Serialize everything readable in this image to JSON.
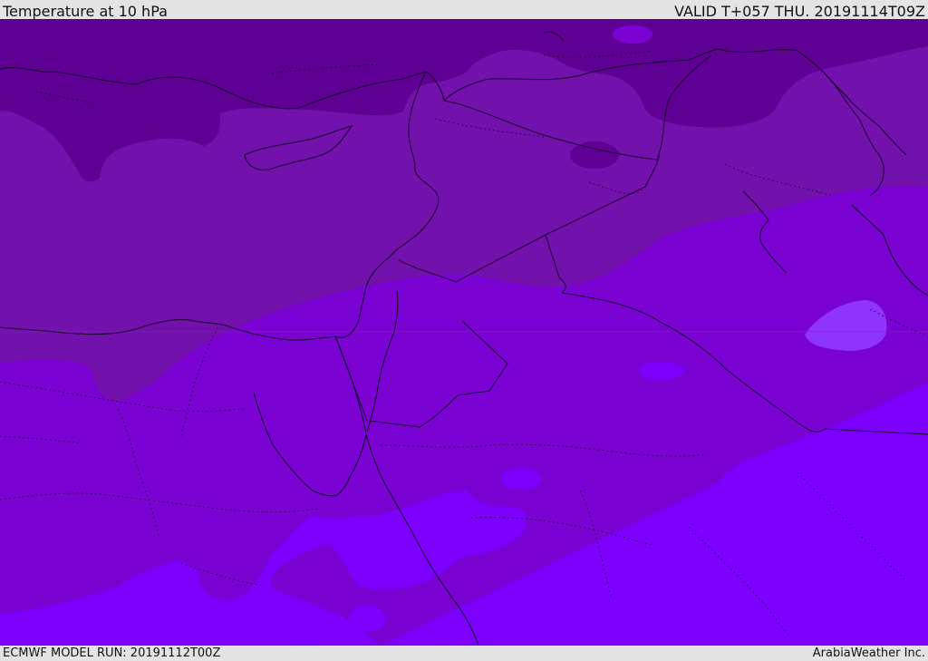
{
  "header": {
    "title": "Temperature at 10 hPa",
    "valid": "VALID T+057 THU. 20191114T09Z"
  },
  "footer": {
    "model_run": "ECMWF MODEL RUN: 20191112T00Z",
    "credit": "ArabiaWeather Inc."
  },
  "colors": {
    "band_darkest": "#5e0094",
    "band_dark": "#7311ac",
    "band_mid": "#7a02d2",
    "band_light": "#7d00ff",
    "band_lightest": "#8f33ff",
    "coastline": "#1a0030",
    "border": "#1a0030"
  }
}
